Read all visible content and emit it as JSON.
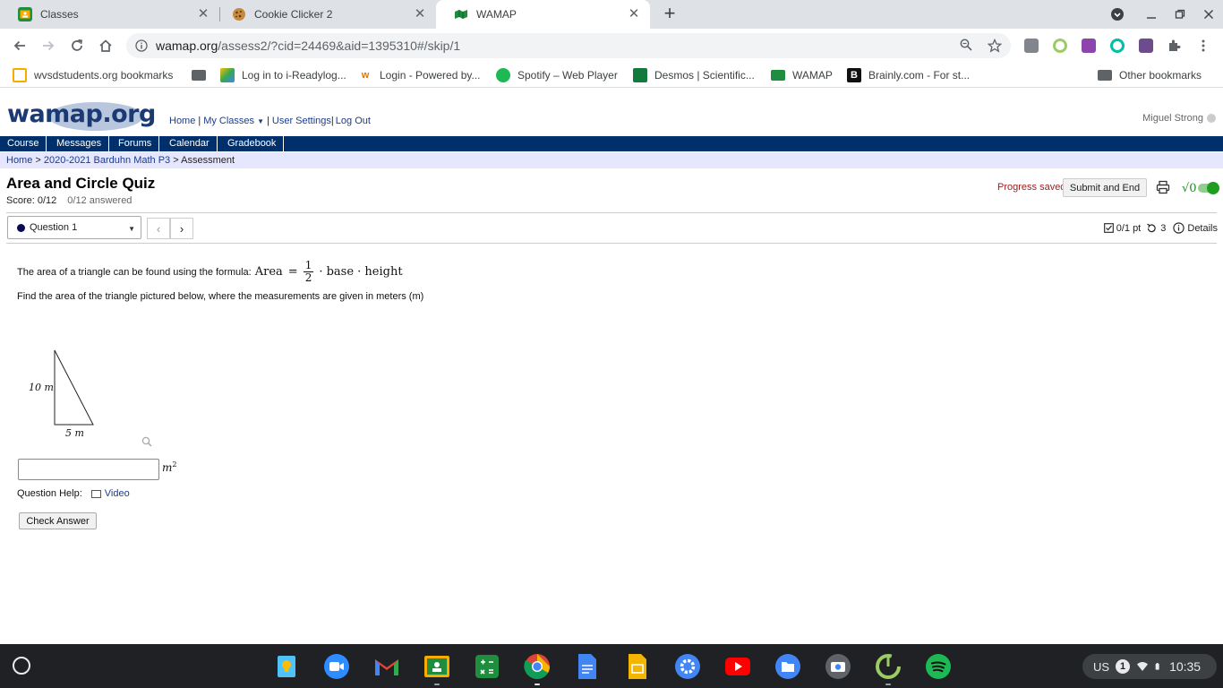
{
  "browser": {
    "tabs": [
      {
        "title": "Classes",
        "active": false
      },
      {
        "title": "Cookie Clicker 2",
        "active": false
      },
      {
        "title": "WAMAP",
        "active": true
      }
    ],
    "url_host": "wamap.org",
    "url_path": "/assess2/?cid=24469&aid=1395310#/skip/1",
    "bookmarks": [
      "wvsdstudents.org bookmarks",
      "Log in to i-Readylog...",
      "Login - Powered by...",
      "Spotify – Web Player",
      "Desmos | Scientific...",
      "WAMAP",
      "Brainly.com - For st..."
    ],
    "other_bookmarks": "Other bookmarks"
  },
  "site": {
    "logo_text": "wamap.org",
    "top_links": {
      "home": "Home",
      "my_classes": "My Classes",
      "user_settings": "User Settings",
      "log_out": "Log Out"
    },
    "user_name": "Miguel Strong",
    "nav": [
      "Course",
      "Messages",
      "Forums",
      "Calendar",
      "Gradebook"
    ],
    "breadcrumb": {
      "home": "Home",
      "course": "2020-2021 Barduhn Math P3",
      "current": "Assessment"
    }
  },
  "quiz": {
    "title": "Area and Circle Quiz",
    "score": "Score: 0/12",
    "answered": "0/12 answered",
    "progress_saved": "Progress saved",
    "submit_label": "Submit and End",
    "question_select": "Question 1",
    "points": "0/1 pt",
    "retries": "3",
    "details": "Details"
  },
  "question": {
    "intro": "The area of a triangle can be found using the formula:",
    "formula_lhs": "Area",
    "formula_num": "1",
    "formula_den": "2",
    "formula_rhs": "· base · height",
    "prompt": "Find the area of the triangle pictured below, where the measurements are given in meters (m)",
    "height_label": "10 m",
    "base_label": "5 m",
    "answer_value": "",
    "unit": "m",
    "unit_exp": "2",
    "help_label": "Question Help:",
    "video_label": "Video",
    "check_label": "Check Answer"
  },
  "system": {
    "locale": "US",
    "notifications": "1",
    "time": "10:35"
  },
  "colors": {
    "nav_bg": "#00306b",
    "breadcrumb_bg": "#e6e6ff",
    "progress_text": "#9b1c1c",
    "link": "#1a3c8c"
  }
}
